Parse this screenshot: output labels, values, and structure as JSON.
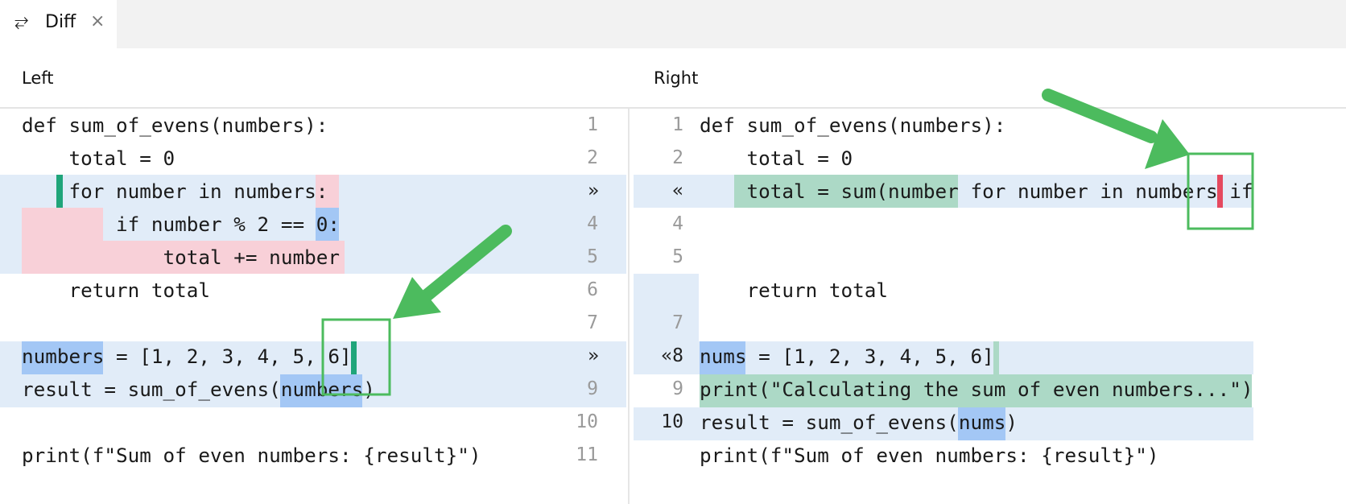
{
  "tab": {
    "icon": "diff-icon",
    "label": "Diff",
    "close": "×"
  },
  "left": {
    "header": "Left",
    "lines": [
      {
        "num": "1",
        "text": "def sum_of_evens(numbers):"
      },
      {
        "num": "2",
        "text": "    total = 0"
      },
      {
        "num": "»",
        "text": "    for number in numbers:"
      },
      {
        "num": "4",
        "text": "        if number % 2 == 0:"
      },
      {
        "num": "5",
        "text": "            total += number"
      },
      {
        "num": "6",
        "text": "    return total"
      },
      {
        "num": "7",
        "text": ""
      },
      {
        "num": "»",
        "text": "numbers = [1, 2, 3, 4, 5, 6]"
      },
      {
        "num": "9",
        "text": "result = sum_of_evens(numbers)"
      },
      {
        "num": "10",
        "text": ""
      },
      {
        "num": "11",
        "text": "print(f\"Sum of even numbers: {result}\")"
      }
    ]
  },
  "right": {
    "header": "Right",
    "lines": [
      {
        "num": "1",
        "text": "def sum_of_evens(numbers):"
      },
      {
        "num": "2",
        "text": "    total = 0"
      },
      {
        "num": "«",
        "text": "    total = sum(number for number in numbers if"
      },
      {
        "num": "4",
        "text": ""
      },
      {
        "num": "5",
        "text": ""
      },
      {
        "num": "",
        "text": "    return total"
      },
      {
        "num": "7",
        "text": ""
      },
      {
        "num": "«8",
        "text": "nums = [1, 2, 3, 4, 5, 6]"
      },
      {
        "num": "9",
        "text": "print(\"Calculating the sum of even numbers...\")"
      },
      {
        "num": "10",
        "text": "result = sum_of_evens(nums)"
      },
      {
        "num": "",
        "text": "print(f\"Sum of even numbers: {result}\")"
      }
    ]
  },
  "colors": {
    "changed": "#e1ecf8",
    "deleted": "#f8d0d8",
    "modified": "#a3c7f5",
    "inserted": "#acd9c6",
    "annotation": "#4cbb5e"
  }
}
